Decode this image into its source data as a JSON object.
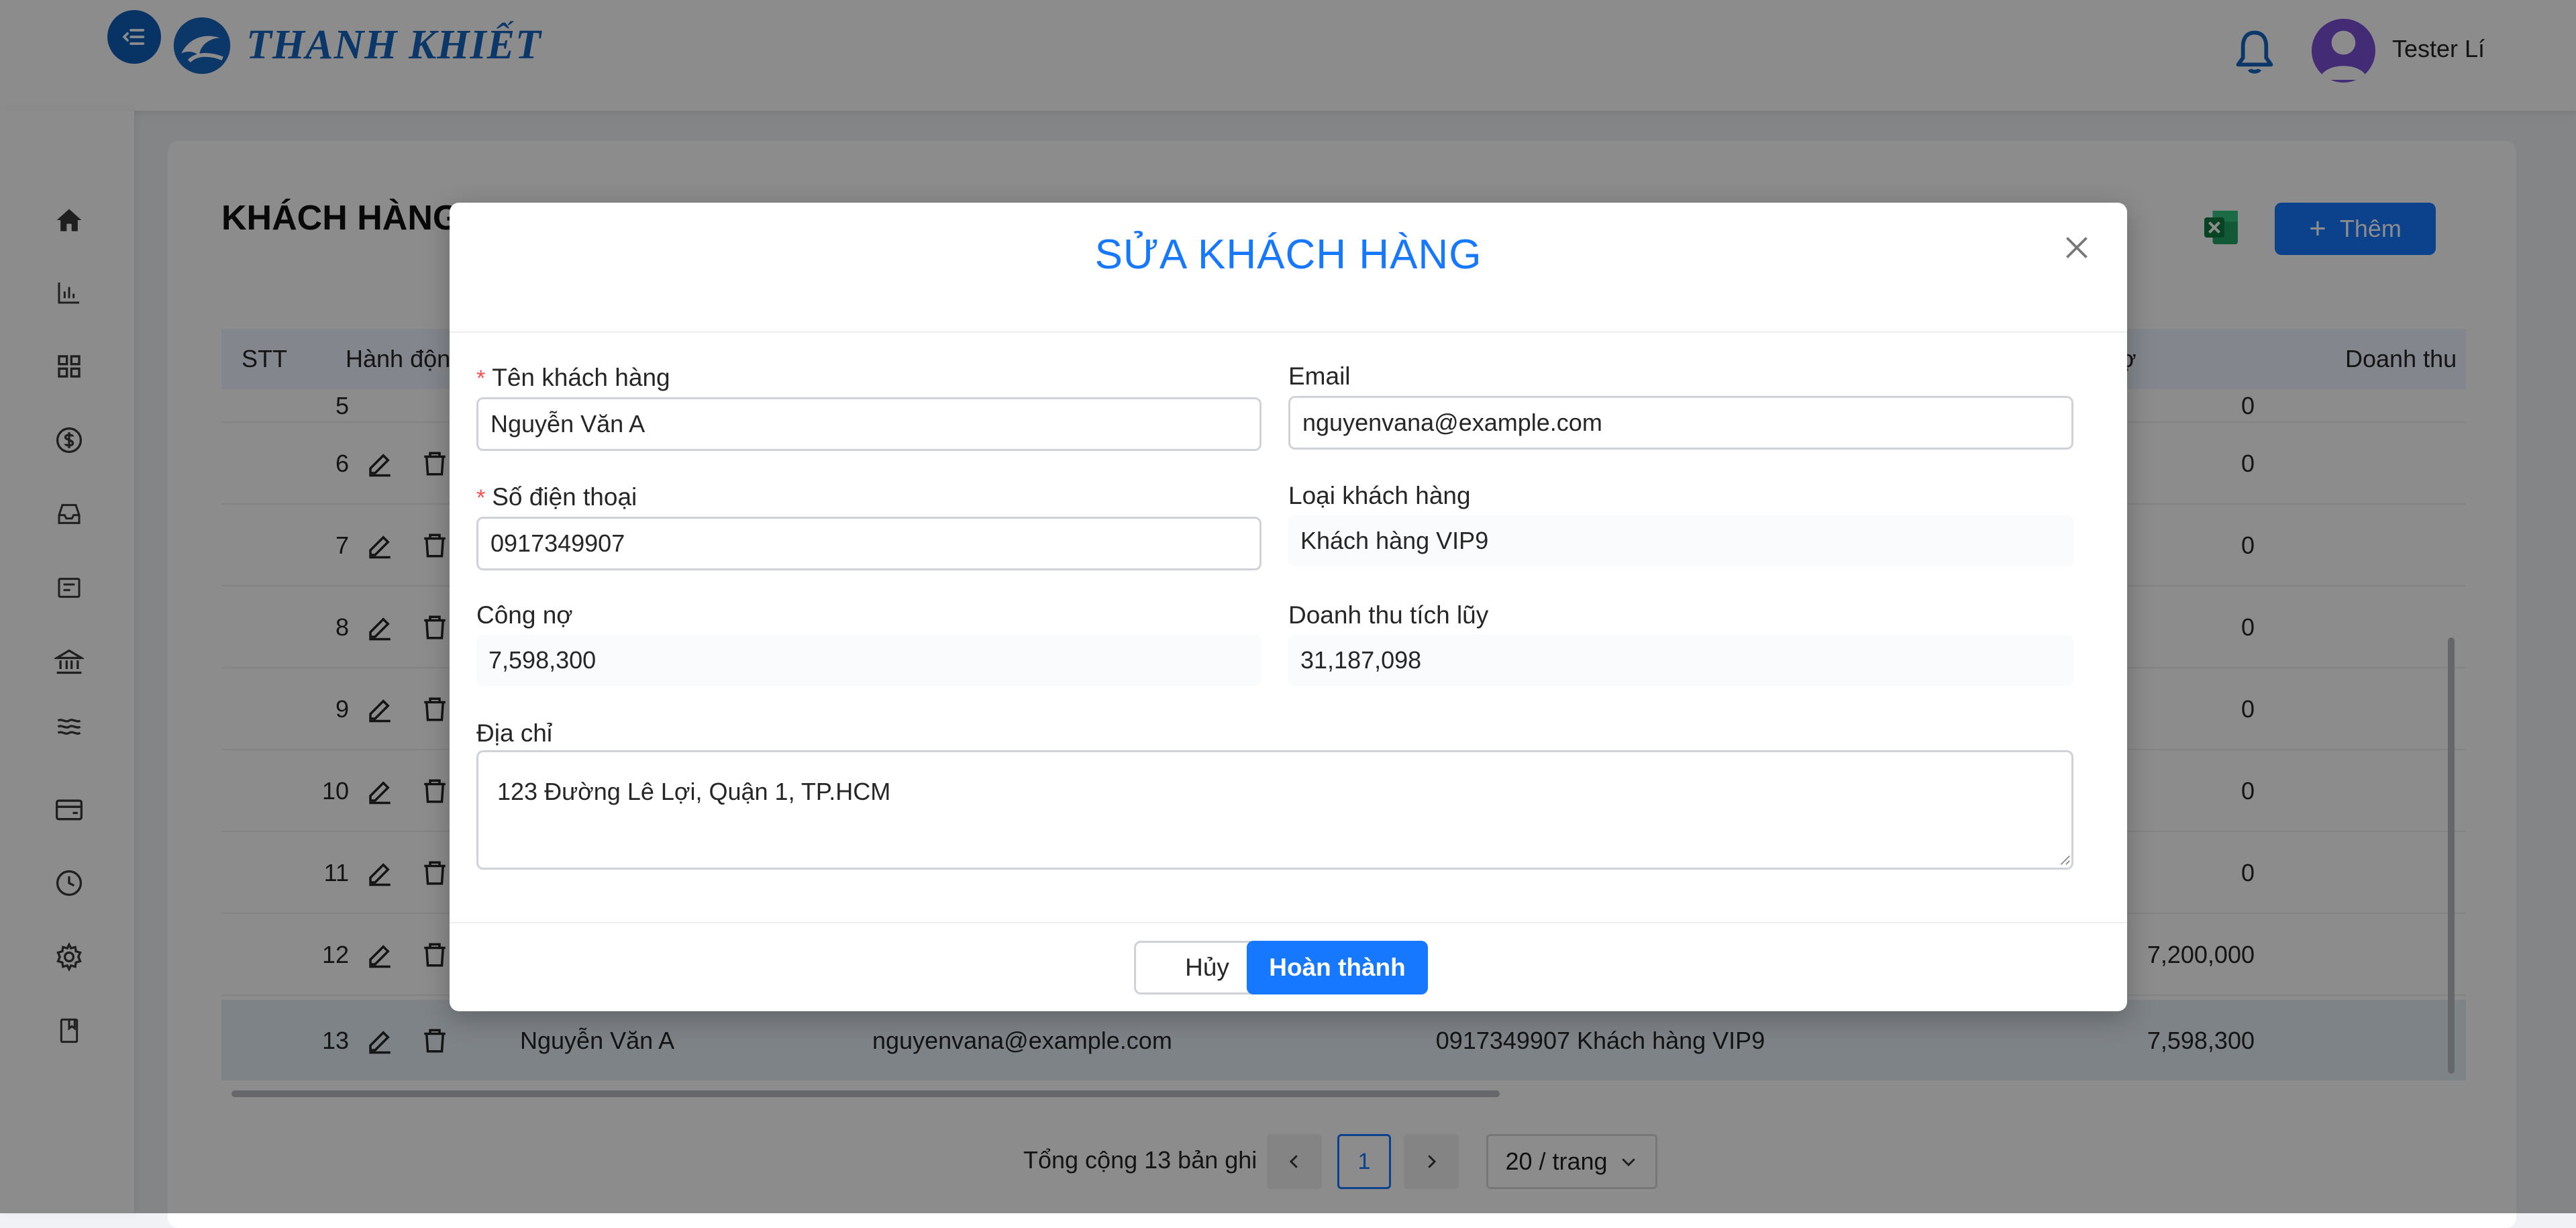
{
  "header": {
    "brand": "THANH KHIẾT",
    "user_name": "Tester Lí"
  },
  "sidebar": {
    "items": [
      {
        "icon": "home-icon"
      },
      {
        "icon": "bar-chart-icon"
      },
      {
        "icon": "grid-icon"
      },
      {
        "icon": "dollar-icon"
      },
      {
        "icon": "inbox-icon"
      },
      {
        "icon": "import-icon"
      },
      {
        "icon": "bank-icon"
      },
      {
        "icon": "layers-icon"
      },
      {
        "icon": "wallet-icon"
      },
      {
        "icon": "history-icon"
      },
      {
        "icon": "settings-icon"
      },
      {
        "icon": "book-icon"
      }
    ]
  },
  "page": {
    "title": "KHÁCH HÀNG",
    "add_label": "Thêm"
  },
  "table": {
    "headers": {
      "stt": "STT",
      "actions": "Hành động",
      "debt": "ợ",
      "revenue": "Doanh thu"
    },
    "partial_row": {
      "stt": "5",
      "debt": "0"
    },
    "rows": [
      {
        "stt": "6",
        "debt": "0"
      },
      {
        "stt": "7",
        "debt": "0"
      },
      {
        "stt": "8",
        "debt": "0"
      },
      {
        "stt": "9",
        "debt": "0"
      },
      {
        "stt": "10",
        "debt": "0"
      },
      {
        "stt": "11",
        "debt": "0"
      },
      {
        "stt": "12",
        "debt": "7,200,000"
      }
    ],
    "selected_row": {
      "stt": "13",
      "name": "Nguyễn Văn A",
      "email": "nguyenvana@example.com",
      "phone": "0917349907",
      "type": "Khách hàng VIP9",
      "debt": "7,598,300"
    }
  },
  "pagination": {
    "total": "Tổng cộng 13 bản ghi",
    "current": "1",
    "page_size": "20 / trang"
  },
  "modal": {
    "title": "SỬA KHÁCH HÀNG",
    "fields": {
      "name": {
        "label": "Tên khách hàng",
        "value": "Nguyễn Văn A"
      },
      "email": {
        "label": "Email",
        "value": "nguyenvana@example.com"
      },
      "phone": {
        "label": "Số điện thoại",
        "value": "0917349907"
      },
      "type": {
        "label": "Loại khách hàng",
        "value": "Khách hàng VIP9"
      },
      "debt": {
        "label": "Công nợ",
        "value": "7,598,300"
      },
      "revenue": {
        "label": "Doanh thu tích lũy",
        "value": "31,187,098"
      },
      "address": {
        "label": "Địa chỉ",
        "value": "123 Đường Lê Lợi, Quận 1, TP.HCM"
      }
    },
    "cancel_label": "Hủy",
    "submit_label": "Hoàn thành"
  },
  "colors": {
    "primary": "#1677ff",
    "brand": "#1565c0",
    "required": "#ff4d4f",
    "avatar": "#7b4fd6"
  }
}
